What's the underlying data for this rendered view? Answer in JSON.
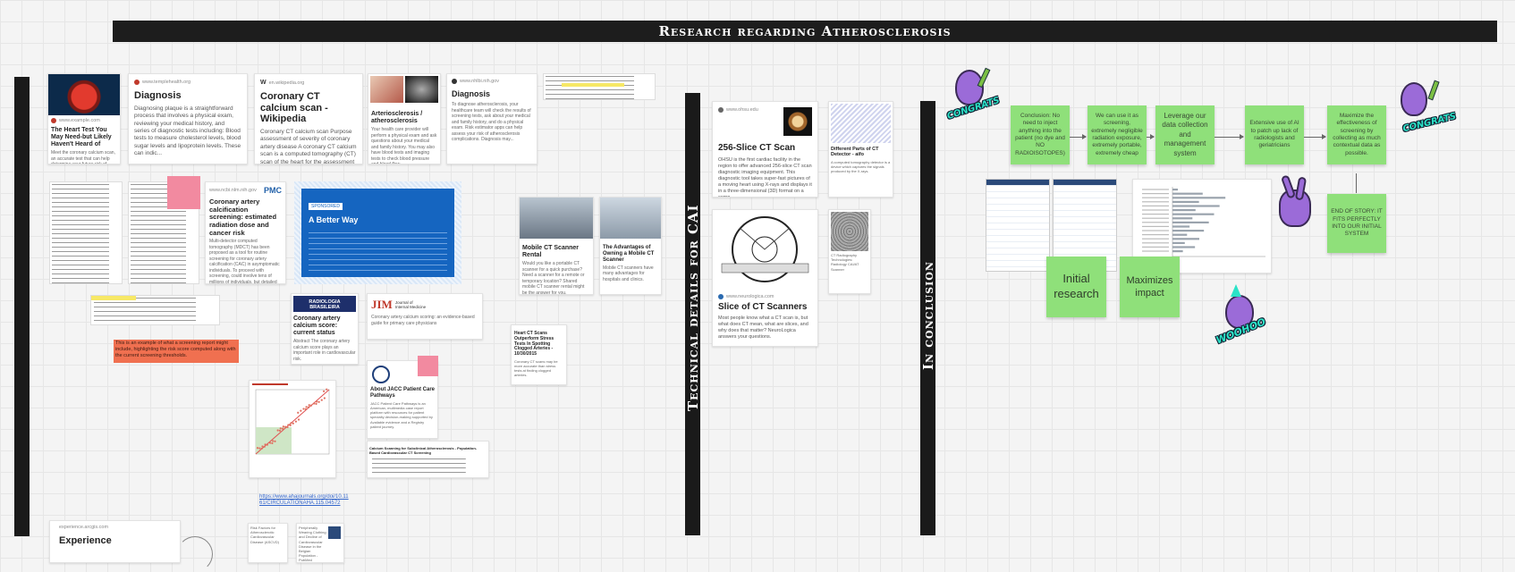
{
  "board": {
    "title": "Research regarding Atherosclerosis",
    "section_technical": "Technical details for CAI",
    "section_conclusion": "In conclusion"
  },
  "cards": {
    "heart_test": {
      "source": "www.example.com",
      "title": "The Heart Test You May Need-but Likely Haven't Heard of",
      "desc": "Meet the coronary calcium scan, an accurate test that can help determine your future risk of heart attack or cardiovascular disease."
    },
    "diagnosis1": {
      "source": "www.templehealth.org",
      "title": "Diagnosis",
      "desc": "Diagnosing plaque is a straightforward process that involves a physical exam, reviewing your medical history, and series of diagnostic tests including: Blood tests to measure cholesterol levels, blood sugar levels and lipoprotein levels. These can indic..."
    },
    "wiki": {
      "source": "en.wikipedia.org",
      "title": "Coronary CT calcium scan - Wikipedia",
      "desc": "Coronary CT calcium scan Purpose assessment of severity of coronary artery disease A coronary CT calcium scan is a computed tomography (CT) scan of the heart for the assessment of severity of coronary artery disease. Specifically, it looks for calcium d..."
    },
    "arteriosclerosis": {
      "title": "Arteriosclerosis / atherosclerosis",
      "desc": "Your health care provider will perform a physical exam and ask questions about your medical and family history. You may also have blood tests and imaging tests to check blood pressure and blood flow."
    },
    "diagnosis2": {
      "source": "www.nhlbi.nih.gov",
      "title": "Diagnosis",
      "desc": "To diagnose atherosclerosis, your healthcare team will check the results of screening tests, ask about your medical and family history, and do a physical exam. Risk estimator apps can help assess your risk of atherosclerosis complications. Diagnosis may..."
    },
    "pmc": {
      "source": "www.ncbi.nlm.nih.gov",
      "logo": "PMC",
      "title": "Coronary artery calcification screening: estimated radiation dose and cancer risk",
      "desc": "Multi-detector computed tomography (MDCT) has been proposed as a tool for routine screening for coronary artery calcification (CAC) in asymptomatic individuals. To proceed with screening, could involve tens of millions of individuals, but detailed ests..."
    },
    "better_way": {
      "tag": "SPONSORED",
      "title": "A Better Way"
    },
    "radiologia": {
      "logo": "RADIOLOGIA BRASILEIRA",
      "title": "Coronary artery calcium score: current status",
      "desc": "Abstract The coronary artery calcium score plays an important role in cardiovascular risk."
    },
    "jim": {
      "logo": "JIM",
      "logo_sub": "Journal of Internal Medicine",
      "desc": "Coronary artery calcium scoring: an evidence-based guide for primary care physicians"
    },
    "jacc": {
      "title": "About JACC Patient Care Pathways",
      "desc": "JACC Patient Care Pathways is an American, multimedia case report platform with resources for patient specialty decision-making supported by Available evidence and a Registry patient journey."
    },
    "mobile_rental": {
      "title": "Mobile CT Scanner Rental",
      "desc": "Would you like a portable CT scanner for a quick purchase? Need a scanner for a remote or temporary location? Shared mobile CT scanner rental might be the answer for you."
    },
    "mobile_advantages": {
      "title": "The Advantages of Owning a Mobile CT Scanner",
      "desc": "Mobile CT scanners have many advantages for hospitals and clinics."
    },
    "heart_ct": {
      "title": "Heart CT Scans Outperform Stress Tests In Spotting Clogged Arteries - 10/30/2015",
      "desc": "Coronary CT scans may be more accurate than stress tests at finding clogged arteries."
    },
    "ct_256": {
      "source": "www.ohsu.edu",
      "title": "256-Slice CT Scan",
      "desc": "OHSU is the first cardiac facility in the region to offer advanced 256-slice CT scan diagnostic imaging equipment. This diagnostic tool takes super-fast pictures of a moving heart using X-rays and displays it in a three-dimensional (3D) format on a comp..."
    },
    "ct_parts": {
      "title": "Different Parts of CT Detector - aifo",
      "desc": "A computed tomography detector is a device which captures the signals produced by the X-rays."
    },
    "slice": {
      "source": "www.neurologica.com",
      "title": "Slice of CT Scanners",
      "desc": "Most people know what a CT scan is, but what does CT mean, what are slices, and why does that matter? NeuroLogica answers your questions."
    },
    "ct_radiography": {
      "title": "CT Radiography Technologies: Radiology CAI/AT Scanner"
    },
    "experience": {
      "source": "experience.arcgis.com",
      "title": "Experience"
    },
    "caption_risk": {
      "title": "Risk Factors for Atherosclerotic Cardiovascular Disease (ASCVD)"
    },
    "peripheral": {
      "title": "Peripherally Wearing Clothing and Decline of Cardiovascular Disease in the Belgian Population - PubMed"
    },
    "ca_scan_screening": {
      "title": "Calcium Scanning for Subclinical Atherosclerosis - Population-Based Cardiovascular CT Screening"
    }
  },
  "link_text": "https://www.ahajournals.org/doi/10.1161/CIRCULATIONAHA.115.04572",
  "highlight_note": "This is an example of what a screening report might include, highlighting the risk score computed along with the current screening thresholds.",
  "flow": [
    "Conclusion: No need to inject anything into the patient (no dye and NO RADIOISOTOPES)",
    "We can use it as screening, extremely negligible radiation exposure, extremely portable, extremely cheap",
    "Leverage our data collection and management system",
    "Extensive use of AI to patch up lack of radiologists and geriatricians",
    "Maximize the effectiveness of screening by collecting as much contextual data as possible."
  ],
  "end_note": "END OF STORY: IT FITS PERFECTLY INTO OUR INITIAL SYSTEM",
  "sticky_initial": "Initial research",
  "sticky_impact": "Maximizes impact",
  "stickers": {
    "congrats": "CONGRATS",
    "woohoo": "WOOHOO"
  }
}
